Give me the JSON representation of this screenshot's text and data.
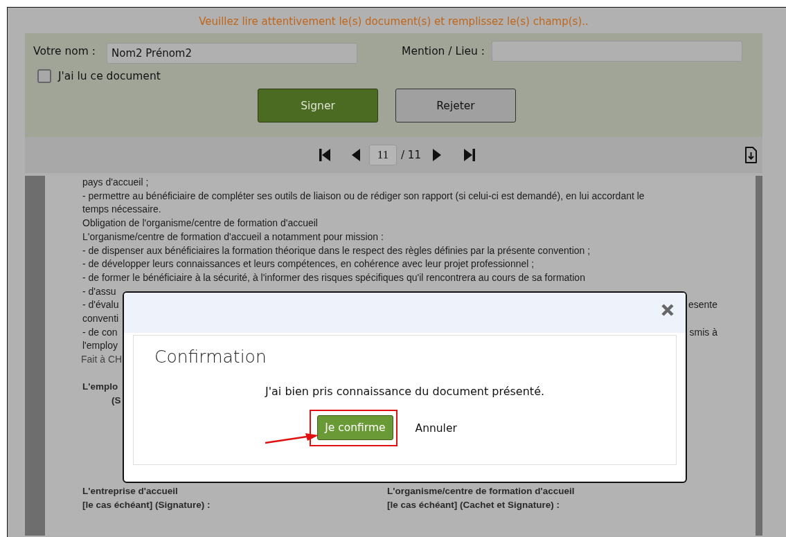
{
  "header": {
    "instruction": "Veuillez lire attentivement le(s) document(s) et remplissez le(s) champ(s).."
  },
  "form": {
    "fields": [
      {
        "label": "Votre nom :",
        "value": "Nom2 Prénom2"
      },
      {
        "label": "Mention / Lieu :"
      }
    ],
    "checkbox": {
      "label": "J'ai lu ce document",
      "checked": false
    },
    "buttons": [
      {
        "label": "Signer",
        "kind": "primary"
      },
      {
        "label": "Rejeter",
        "kind": "secondary"
      }
    ]
  },
  "pager": {
    "page": "11",
    "total": "/ 11"
  },
  "document": {
    "lines": [
      {
        "kind": "text",
        "text": "pays d'accueil ;"
      },
      {
        "kind": "text",
        "text": "- permettre au bénéficiaire de compléter ses outils de liaison ou de rédiger son rapport (si celui-ci est demandé), en lui accordant le"
      },
      {
        "kind": "text",
        "text": "temps nécessaire."
      },
      {
        "kind": "text",
        "text": "Obligation de l'organisme/centre de formation d'accueil"
      },
      {
        "kind": "text",
        "text": "L'organisme/centre de formation d'accueil a notamment pour mission :"
      },
      {
        "kind": "text",
        "text": "- de dispenser aux bénéficiaires la formation théorique dans le respect des règles définies par la présente convention ;"
      },
      {
        "kind": "text",
        "text": "- de développer leurs connaissances et leurs compétences, en cohérence avec leur projet professionnel ;"
      },
      {
        "kind": "text",
        "text": "- de former le bénéficiaire à la sécurité, à l'informer des risques spécifiques qu'il rencontrera au cours de sa formation"
      },
      {
        "kind": "text",
        "text": "- d'assu"
      },
      {
        "kind": "split",
        "text": "- d'évalu",
        "right": "esente"
      },
      {
        "kind": "text",
        "text": "conventi"
      },
      {
        "kind": "split",
        "text": "- de con",
        "right": "smis à"
      },
      {
        "kind": "text",
        "text": "l'employ"
      },
      {
        "kind": "note",
        "text": "Fait à CH"
      },
      {
        "kind": "heading",
        "text": "L'emplo"
      },
      {
        "kind": "indented",
        "text": "(S"
      },
      {
        "kind": "columns-heading",
        "text": "L'entreprise d'accueil",
        "right": "L'organisme/centre de formation d'accueil"
      },
      {
        "kind": "columns",
        "text": "[le cas échéant] (Signature) :",
        "right": "[le cas échéant] (Cachet et Signature) :"
      }
    ]
  },
  "dialog": {
    "title": "Confirmation",
    "message": "J'ai bien pris connaissance du document présenté.",
    "buttons": [
      {
        "label": "Je confirme",
        "kind": "primary",
        "highlighted": true
      },
      {
        "label": "Annuler",
        "kind": "link",
        "highlighted": false
      }
    ]
  }
}
